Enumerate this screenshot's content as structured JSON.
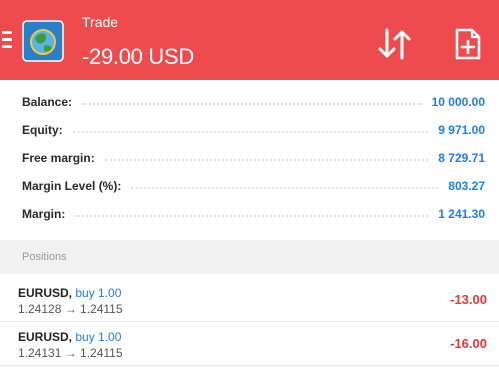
{
  "header": {
    "title": "Trade",
    "profit": "-29.00 USD",
    "accent_color": "#ee4b4e",
    "icons": [
      "menu-icon",
      "metatrader-logo-icon",
      "sort-arrows-icon",
      "new-order-icon"
    ]
  },
  "summary": [
    {
      "label": "Balance:",
      "value": "10 000.00"
    },
    {
      "label": "Equity:",
      "value": "9 971.00"
    },
    {
      "label": "Free margin:",
      "value": "8 729.71"
    },
    {
      "label": "Margin Level (%):",
      "value": "803.27"
    },
    {
      "label": "Margin:",
      "value": "1 241.30"
    }
  ],
  "positions": {
    "header": "Positions",
    "items": [
      {
        "symbol": "EURUSD,",
        "action": "buy 1.00",
        "prices": "1.24128 → 1.24115",
        "profit": "-13.00"
      },
      {
        "symbol": "EURUSD,",
        "action": "buy 1.00",
        "prices": "1.24131 → 1.24115",
        "profit": "-16.00"
      }
    ]
  }
}
